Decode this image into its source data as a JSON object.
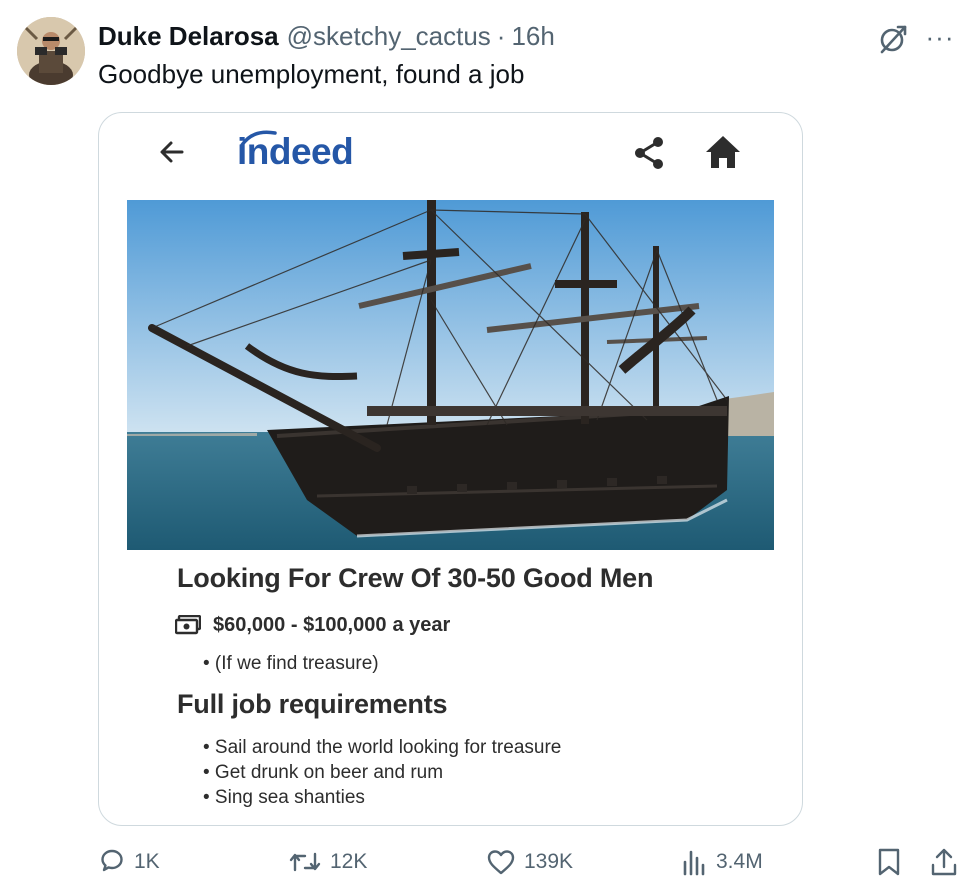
{
  "tweet": {
    "author_name": "Duke Delarosa",
    "author_handle": "@sketchy_cactus",
    "separator": "·",
    "time": "16h",
    "text": "Goodbye unemployment, found a job"
  },
  "icons": {
    "grok": "grok-icon",
    "more": "more-icon",
    "back": "arrow-left-icon",
    "share": "share-icon",
    "home": "home-icon",
    "money": "money-icon",
    "reply": "reply-icon",
    "repost": "repost-icon",
    "like": "heart-icon",
    "views": "views-icon",
    "bookmark": "bookmark-icon",
    "tweet_share": "upload-icon"
  },
  "more_label": "···",
  "indeed": {
    "logo": "indeed",
    "brand_color": "#2557a7",
    "job_title": "Looking For Crew Of 30-50 Good Men",
    "salary_range": "$60,000 - $100,000",
    "salary_unit": "a year",
    "salary_note": "• (If we find treasure)",
    "requirements_heading": "Full job requirements",
    "requirements": [
      "• Sail around the world looking for treasure",
      "• Get drunk on beer and rum",
      "• Sing sea shanties"
    ]
  },
  "actions": {
    "replies": "1K",
    "reposts": "12K",
    "likes": "139K",
    "views": "3.4M"
  },
  "colors": {
    "text": "#0f1419",
    "secondary": "#536471",
    "border": "#cfd9de"
  }
}
